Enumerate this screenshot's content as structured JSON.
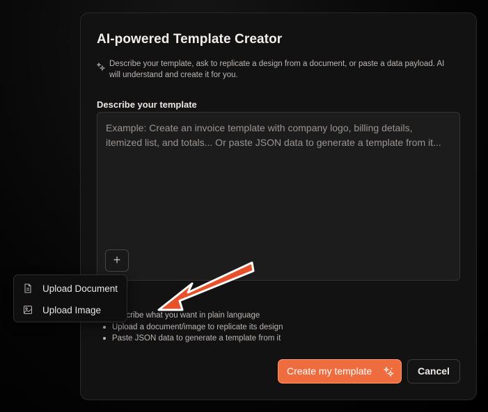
{
  "dialog": {
    "title": "AI-powered Template Creator",
    "description": "Describe your template, ask to replicate a design from a document, or paste a data payload. AI will understand and create it for you.",
    "field_label": "Describe your template",
    "textarea_placeholder": "Example: Create an invoice template with company logo, billing details, itemized list, and totals... Or paste JSON data to generate a template from it...",
    "attach_button_glyph": "+",
    "tips": [
      "Describe what you want in plain language",
      "Upload a document/image to replicate its design",
      "Paste JSON data to generate a template from it"
    ],
    "create_button_label": "Create my template",
    "cancel_button_label": "Cancel"
  },
  "attach_menu": {
    "items": [
      {
        "label": "Upload Document",
        "icon": "document-icon"
      },
      {
        "label": "Upload Image",
        "icon": "image-icon"
      }
    ]
  },
  "colors": {
    "accent": "#ee6c3e",
    "annotation_arrow": "#e8502a",
    "dialog_bg": "#121212"
  },
  "icons": {
    "sparkles": "sparkles-icon"
  }
}
